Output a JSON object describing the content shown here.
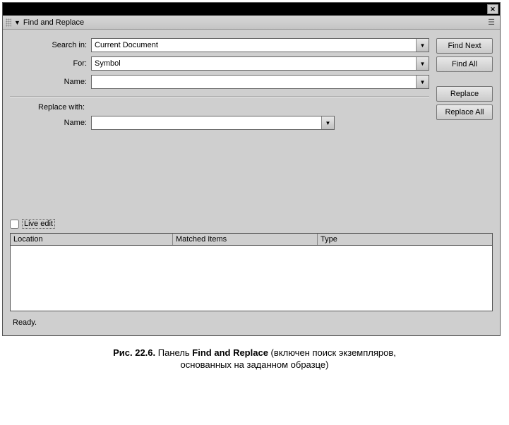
{
  "header": {
    "title": "Find and Replace"
  },
  "labels": {
    "search_in": "Search in:",
    "for": "For:",
    "name": "Name:",
    "replace_with": "Replace with:",
    "replace_name": "Name:",
    "live_edit": "Live edit"
  },
  "fields": {
    "search_in_value": "Current Document",
    "for_value": "Symbol",
    "name_value": "",
    "replace_name_value": ""
  },
  "buttons": {
    "find_next": "Find Next",
    "find_all": "Find All",
    "replace": "Replace",
    "replace_all": "Replace All"
  },
  "columns": {
    "location": "Location",
    "matched": "Matched Items",
    "type": "Type"
  },
  "status": "Ready.",
  "caption": {
    "prefix": "Рис. 22.6. ",
    "mid1": "Панель ",
    "bold": "Find and Replace",
    "tail1": " (включен поиск экземпляров,",
    "tail2": "основанных на заданном образце)"
  }
}
